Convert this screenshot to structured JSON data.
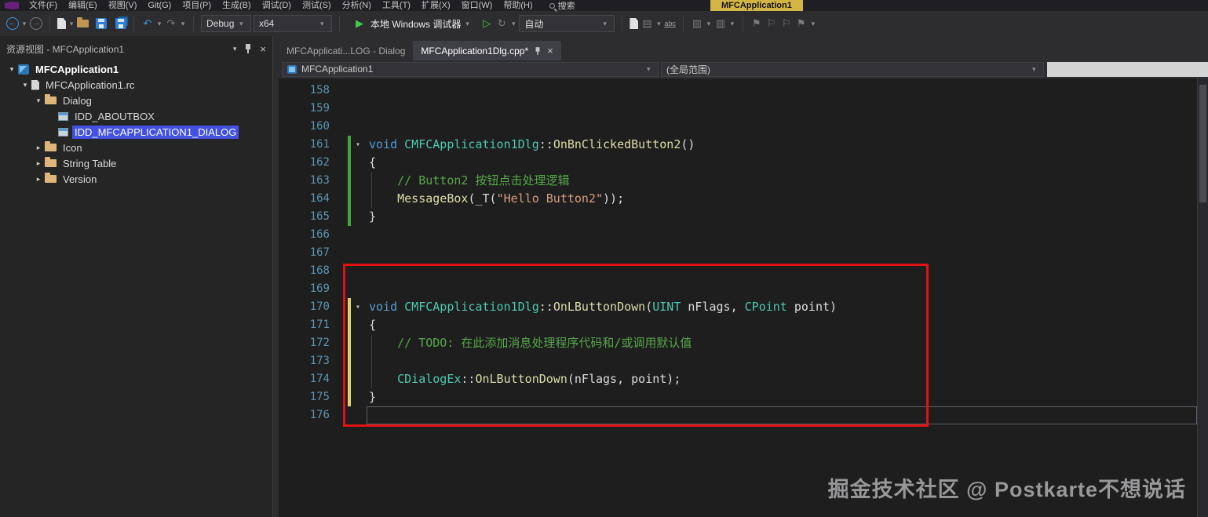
{
  "title_bar": {
    "menu_items": [
      "文件(F)",
      "编辑(E)",
      "视图(V)",
      "Git(G)",
      "项目(P)",
      "生成(B)",
      "调试(D)",
      "测试(S)",
      "分析(N)",
      "工具(T)",
      "扩展(X)",
      "窗口(W)",
      "帮助(H)"
    ],
    "search_label": "搜索",
    "solution_badge": "MFCApplication1"
  },
  "toolbar": {
    "debug_config": "Debug",
    "platform": "x64",
    "start_debug": "本地 Windows 调试器",
    "exceptions_mode": "自动"
  },
  "icons": {
    "back": "←",
    "forward": "→",
    "caret": "▾",
    "undo": "↶",
    "redo": "↷",
    "play": "▶",
    "play_outline": "▷",
    "hot_reload": "↻",
    "member_list": "▤",
    "comment": "▥",
    "uncomment": "▥",
    "abc": "abc",
    "bookmark": "⚑",
    "bookmark_outline": "⚐",
    "panel_menu": "▾",
    "close": "×",
    "tree_expanded": "▾",
    "tree_collapsed": "▸",
    "fold_open": "▾"
  },
  "resource_view": {
    "title": "资源视图 - MFCApplication1",
    "items": [
      {
        "label": "MFCApplication1",
        "level": 0,
        "arrow": "expanded",
        "icon": "app",
        "bold": true
      },
      {
        "label": "MFCApplication1.rc",
        "level": 1,
        "arrow": "expanded",
        "icon": "doc"
      },
      {
        "label": "Dialog",
        "level": 2,
        "arrow": "expanded",
        "icon": "folder"
      },
      {
        "label": "IDD_ABOUTBOX",
        "level": 3,
        "arrow": "none",
        "icon": "dialog"
      },
      {
        "label": "IDD_MFCAPPLICATION1_DIALOG",
        "level": 3,
        "arrow": "none",
        "icon": "dialog",
        "selected": true
      },
      {
        "label": "Icon",
        "level": 2,
        "arrow": "collapsed",
        "icon": "folder"
      },
      {
        "label": "String Table",
        "level": 2,
        "arrow": "collapsed",
        "icon": "folder"
      },
      {
        "label": "Version",
        "level": 2,
        "arrow": "collapsed",
        "icon": "folder"
      }
    ]
  },
  "editor": {
    "tabs": [
      {
        "label": "MFCApplicati...LOG - Dialog"
      },
      {
        "label": "MFCApplication1Dlg.cpp*"
      }
    ],
    "nav_left": "MFCApplication1",
    "nav_right": "(全局范围)",
    "lines": [
      {
        "n": 158,
        "tokens": []
      },
      {
        "n": 159,
        "tokens": []
      },
      {
        "n": 160,
        "tokens": []
      },
      {
        "n": 161,
        "fold": true,
        "mark": "green",
        "tokens": [
          [
            "k",
            "void"
          ],
          [
            "p",
            " "
          ],
          [
            "t",
            "CMFCApplication1Dlg"
          ],
          [
            "p",
            "::"
          ],
          [
            "f",
            "OnBnClickedButton2"
          ],
          [
            "p",
            "()"
          ]
        ]
      },
      {
        "n": 162,
        "mark": "green",
        "tokens": [
          [
            "p",
            "{"
          ]
        ]
      },
      {
        "n": 163,
        "mark": "green",
        "guide": true,
        "tokens": [
          [
            "p",
            "    "
          ],
          [
            "c",
            "// Button2 按钮点击处理逻辑"
          ]
        ]
      },
      {
        "n": 164,
        "mark": "green",
        "guide": true,
        "tokens": [
          [
            "p",
            "    "
          ],
          [
            "f",
            "MessageBox"
          ],
          [
            "p",
            "(_T("
          ],
          [
            "s",
            "\"Hello Button2\""
          ],
          [
            "p",
            "));"
          ]
        ]
      },
      {
        "n": 165,
        "mark": "green",
        "tokens": [
          [
            "p",
            "}"
          ]
        ]
      },
      {
        "n": 166,
        "tokens": []
      },
      {
        "n": 167,
        "tokens": []
      },
      {
        "n": 168,
        "tokens": []
      },
      {
        "n": 169,
        "tokens": []
      },
      {
        "n": 170,
        "fold": true,
        "mark": "yellow",
        "tokens": [
          [
            "k",
            "void"
          ],
          [
            "p",
            " "
          ],
          [
            "t",
            "CMFCApplication1Dlg"
          ],
          [
            "p",
            "::"
          ],
          [
            "f",
            "OnLButtonDown"
          ],
          [
            "p",
            "("
          ],
          [
            "t",
            "UINT"
          ],
          [
            "p",
            " nFlags, "
          ],
          [
            "t",
            "CPoint"
          ],
          [
            "p",
            " point)"
          ]
        ]
      },
      {
        "n": 171,
        "mark": "yellow",
        "tokens": [
          [
            "p",
            "{"
          ]
        ]
      },
      {
        "n": 172,
        "mark": "yellow",
        "guide": true,
        "tokens": [
          [
            "p",
            "    "
          ],
          [
            "c",
            "// TODO: 在此添加消息处理程序代码和/或调用默认值"
          ]
        ]
      },
      {
        "n": 173,
        "mark": "yellow",
        "guide": true,
        "tokens": []
      },
      {
        "n": 174,
        "mark": "yellow",
        "guide": true,
        "tokens": [
          [
            "p",
            "    "
          ],
          [
            "t",
            "CDialogEx"
          ],
          [
            "p",
            "::"
          ],
          [
            "f",
            "OnLButtonDown"
          ],
          [
            "p",
            "(nFlags, point);"
          ]
        ]
      },
      {
        "n": 175,
        "mark": "yellow",
        "tokens": [
          [
            "p",
            "}"
          ]
        ]
      },
      {
        "n": 176,
        "caret": true,
        "tokens": []
      }
    ]
  },
  "watermark": "掘金技术社区 @ Postkarte不想说话",
  "colors": {
    "selection": "#4251e0",
    "annotation": "#e01212",
    "keyword": "#569cd6",
    "type": "#4ec9b0",
    "function": "#dcdcaa",
    "comment": "#57a64a",
    "string": "#d69d85"
  }
}
